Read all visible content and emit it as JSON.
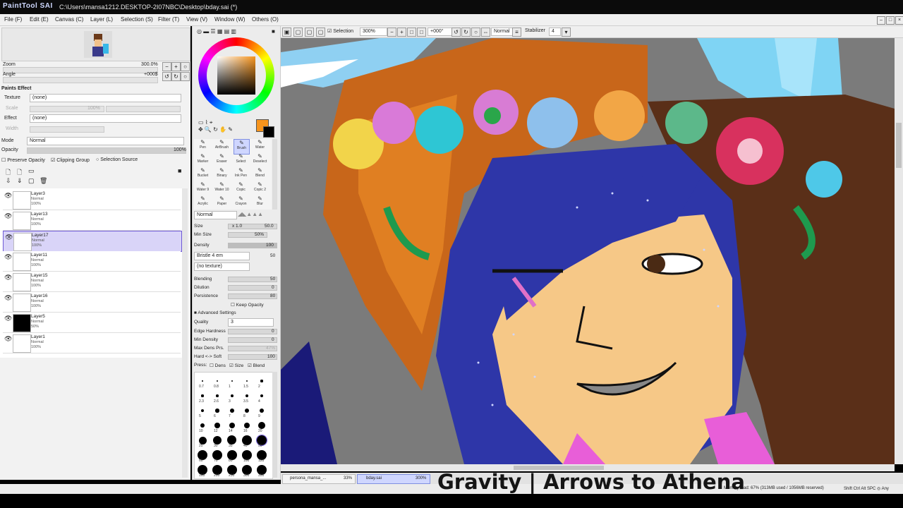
{
  "app": {
    "logo": "PaintTool SAI",
    "title": "C:\\Users\\mansa1212.DESKTOP-2I07NBC\\Desktop\\bday.sai (*)",
    "window_buttons": [
      "–",
      "□",
      "×"
    ]
  },
  "menu": [
    "File (F)",
    "Edit (E)",
    "Canvas (C)",
    "Layer (L)",
    "Selection (S)",
    "Filter (T)",
    "View (V)",
    "Window (W)",
    "Others (O)"
  ],
  "navigator": {
    "zoom_label": "Zoom",
    "zoom_value": "300.0%",
    "angle_label": "Angle",
    "angle_value": "+000$"
  },
  "paint_effect": {
    "header": "Paints Effect",
    "texture_label": "Texture",
    "texture_value": "(none)",
    "scale_label": "Scale",
    "scale_value": "100%",
    "strength_label": "Strength",
    "strength_value": "20",
    "effect_label": "Effect",
    "effect_value": "(none)",
    "width_label": "Width",
    "width_value": "1"
  },
  "layer_props": {
    "mode_label": "Mode",
    "mode_value": "Normal",
    "opacity_label": "Opacity",
    "opacity_value": "100%",
    "preserve_opacity": "Preserve Opacity",
    "clipping_group": "Clipping Group",
    "selection_source": "Selection Source"
  },
  "layers": [
    {
      "name": "Layer3",
      "mode": "Normal",
      "opacity": "100%",
      "selected": false
    },
    {
      "name": "Layer13",
      "mode": "Normal",
      "opacity": "100%",
      "selected": false
    },
    {
      "name": "Layer17",
      "mode": "Normal",
      "opacity": "100%",
      "selected": true
    },
    {
      "name": "Layer11",
      "mode": "Normal",
      "opacity": "100%",
      "selected": false
    },
    {
      "name": "Layer15",
      "mode": "Normal",
      "opacity": "100%",
      "selected": false
    },
    {
      "name": "Layer16",
      "mode": "Normal",
      "opacity": "100%",
      "selected": false
    },
    {
      "name": "Layer5",
      "mode": "Normal",
      "opacity": "50%",
      "selected": false
    },
    {
      "name": "Layer1",
      "mode": "Normal",
      "opacity": "100%",
      "selected": false
    }
  ],
  "colors": {
    "primary": "#f7941d",
    "secondary": "#000000",
    "accent_selected": "#d9d4f8"
  },
  "tools": [
    [
      "Pen",
      "AirBrush",
      "Brush",
      "Water"
    ],
    [
      "Marker",
      "Eraser",
      "Select",
      "Deselect"
    ],
    [
      "Bucket",
      "Binary",
      "Ink Pen",
      "Blend"
    ],
    [
      "Water 9",
      "Water 10",
      "Copic",
      "Copic 2"
    ],
    [
      "Acrylic",
      "Paper",
      "Crayon",
      "Blur"
    ]
  ],
  "brush": {
    "blend_mode": "Normal",
    "size_label": "Size",
    "size_mult": "x 1.0",
    "size_value": "50.0",
    "min_size_label": "Min Size",
    "min_size_value": "50%",
    "density_label": "Density",
    "density_value": "100",
    "shape": "Bristle 4 em",
    "shape_value": "50",
    "texture": "(no texture)",
    "blending_label": "Blending",
    "blending_value": "50",
    "dilution_label": "Dilution",
    "dilution_value": "0",
    "persistence_label": "Persistence",
    "persistence_value": "80",
    "keep_opacity": "Keep Opacity",
    "advanced": "Advanced Settings",
    "quality_label": "Quality",
    "quality_value": "3",
    "edge_hardness_label": "Edge Hardness",
    "edge_hardness_value": "0",
    "min_density_label": "Min Density",
    "min_density_value": "0",
    "max_dens_label": "Max Dens Prs.",
    "max_dens_value": "47%",
    "hard_soft_label": "Hard <-> Soft",
    "hard_soft_value": "100",
    "press_label": "Press:",
    "press_dens": "Dens",
    "press_size": "Size",
    "press_blend": "Blend"
  },
  "brush_sizes": [
    "0.7",
    "0.8",
    "1",
    "1.5",
    "2",
    "2.3",
    "2.6",
    "3",
    "3.5",
    "4",
    "5",
    "6",
    "7",
    "8",
    "9",
    "10",
    "12",
    "14",
    "16",
    "20",
    "25",
    "30",
    "35",
    "40",
    "50",
    "60",
    "70",
    "80",
    "100",
    "120",
    "160",
    "200",
    "250",
    "300",
    "350"
  ],
  "canvas_toolbar": {
    "selection_label": "Selection",
    "zoom_value": "300%",
    "angle_value": "+000°",
    "blend_value": "Normal",
    "stabilizer_label": "Stabilizer",
    "stabilizer_value": "4"
  },
  "tabs": [
    {
      "name": "persona_mansa_...",
      "zoom": "33%"
    },
    {
      "name": "bday.sai",
      "zoom": "300%"
    }
  ],
  "status": {
    "memory": "Memory load: 67% (313MB used / 1056MB reserved)",
    "keys": "Shift Ctrl Alt SPC ◎ Any"
  },
  "overlay_caption": "Gravity  | Arrows to Athena"
}
